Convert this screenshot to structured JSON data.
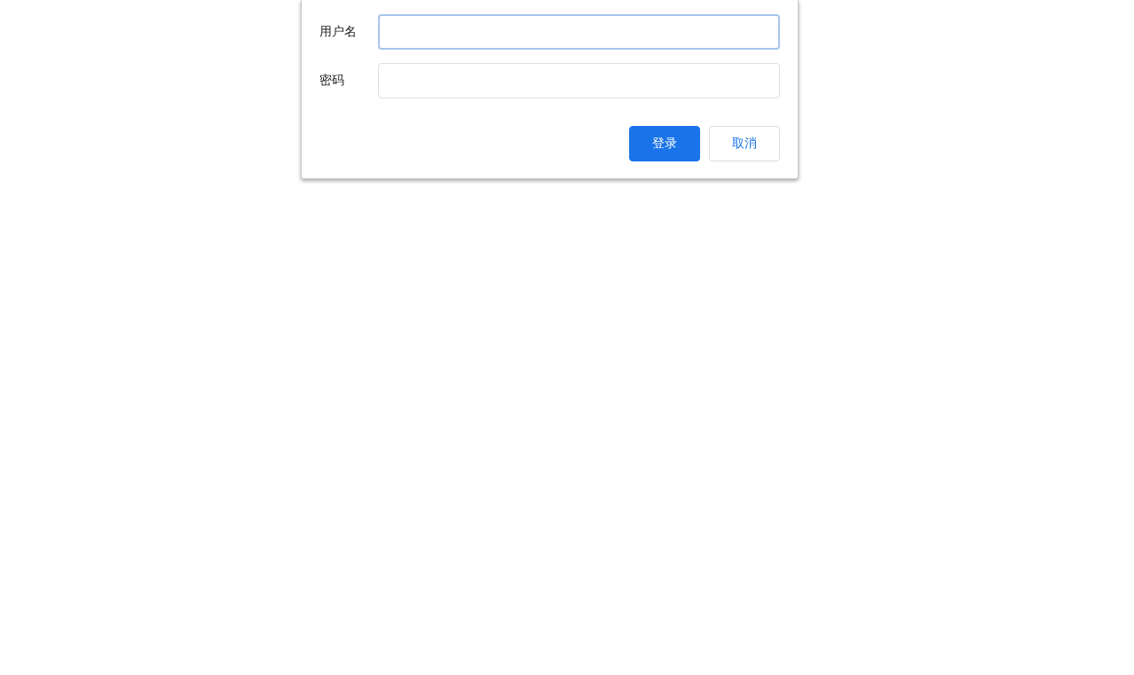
{
  "login_form": {
    "fields": [
      {
        "label": "用户名",
        "focused": true
      },
      {
        "label": "密码",
        "focused": false
      }
    ],
    "buttons": [
      {
        "label": "登录",
        "kind": "primary"
      },
      {
        "label": "取消",
        "kind": "secondary"
      }
    ]
  }
}
